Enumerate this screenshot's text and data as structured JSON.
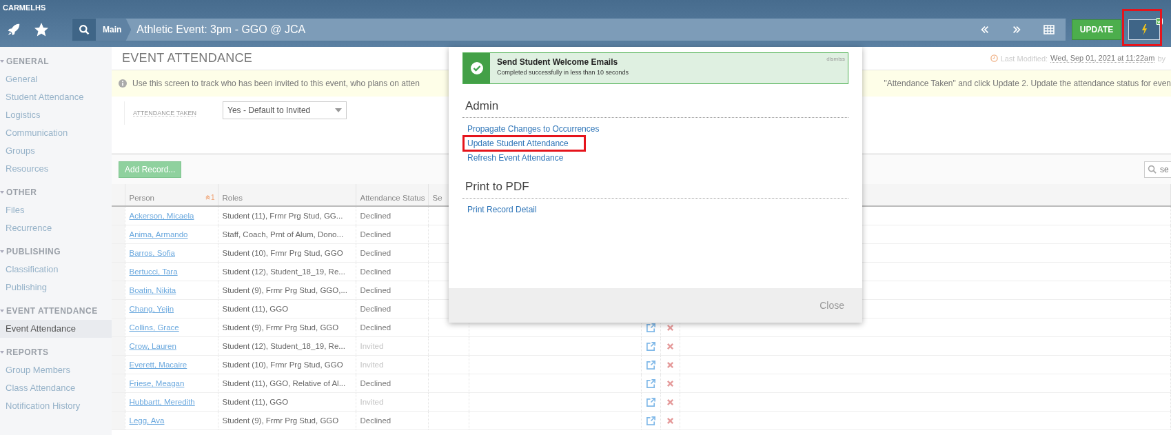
{
  "app": {
    "name": "CARMELHS"
  },
  "nav": {
    "search_label": "Main",
    "title": "Athletic Event: 3pm - GGO @ JCA",
    "update_button": "UPDATE",
    "actions_badge": true
  },
  "sidebar": [
    {
      "title": "GENERAL",
      "items": [
        {
          "label": "General",
          "selected": false
        },
        {
          "label": "Student Attendance",
          "selected": false
        },
        {
          "label": "Logistics",
          "selected": false
        },
        {
          "label": "Communication",
          "selected": false
        },
        {
          "label": "Groups",
          "selected": false
        },
        {
          "label": "Resources",
          "selected": false
        }
      ]
    },
    {
      "title": "OTHER",
      "items": [
        {
          "label": "Files",
          "selected": false
        },
        {
          "label": "Recurrence",
          "selected": false
        }
      ]
    },
    {
      "title": "PUBLISHING",
      "items": [
        {
          "label": "Classification",
          "selected": false
        },
        {
          "label": "Publishing",
          "selected": false
        }
      ]
    },
    {
      "title": "EVENT ATTENDANCE",
      "items": [
        {
          "label": "Event Attendance",
          "selected": true
        }
      ]
    },
    {
      "title": "REPORTS",
      "items": [
        {
          "label": "Group Members",
          "selected": false
        },
        {
          "label": "Class Attendance",
          "selected": false
        },
        {
          "label": "Notification History",
          "selected": false
        }
      ]
    }
  ],
  "page": {
    "title": "EVENT ATTENDANCE",
    "modified_label": "Last Modified:",
    "modified_value": "Wed, Sep 01, 2021 at 11:22am",
    "modified_by": "by",
    "info_left": "Use this screen to track who has been invited to this event, who plans on atten",
    "info_right": "\"Attendance Taken\" and click Update 2. Update the attendance status for even",
    "attendance_label": "ATTENDANCE TAKEN",
    "attendance_value": "Yes - Default to Invited",
    "add_button": "Add Record...",
    "search_placeholder": "se"
  },
  "table": {
    "columns": [
      "Person",
      "Roles",
      "Attendance Status",
      "Se"
    ],
    "sort_index": "1",
    "rows": [
      {
        "person": "Ackerson, Micaela",
        "roles": "Student (11), Frmr Prg Stud, GG...",
        "status": "Declined",
        "dimmed": false
      },
      {
        "person": "Anima, Armando",
        "roles": "Staff, Coach, Prnt of Alum, Dono...",
        "status": "Declined",
        "dimmed": false
      },
      {
        "person": "Barros, Sofia",
        "roles": "Student (10), Frmr Prg Stud, GGO",
        "status": "Declined",
        "dimmed": false
      },
      {
        "person": "Bertucci, Tara",
        "roles": "Student (12), Student_18_19, Re...",
        "status": "Declined",
        "dimmed": false
      },
      {
        "person": "Boatin, Nikita",
        "roles": "Student (9), Frmr Prg Stud, GGO,...",
        "status": "Declined",
        "dimmed": false
      },
      {
        "person": "Chang, Yejin",
        "roles": "Student (11), GGO",
        "status": "Declined",
        "dimmed": false
      },
      {
        "person": "Collins, Grace",
        "roles": "Student (9), Frmr Prg Stud, GGO",
        "status": "Declined",
        "dimmed": false
      },
      {
        "person": "Crow, Lauren",
        "roles": "Student (12), Student_18_19, Re...",
        "status": "Invited",
        "dimmed": true
      },
      {
        "person": "Everett, Macaire",
        "roles": "Student (10), Frmr Prg Stud, GGO",
        "status": "Invited",
        "dimmed": true
      },
      {
        "person": "Friese, Meagan",
        "roles": "Student (11), GGO, Relative of Al...",
        "status": "Declined",
        "dimmed": false
      },
      {
        "person": "Hubbartt, Meredith",
        "roles": "Student (11), GGO",
        "status": "Invited",
        "dimmed": true
      },
      {
        "person": "Legg, Ava",
        "roles": "Student (9), Frmr Prg Stud, GGO",
        "status": "Declined",
        "dimmed": false
      }
    ]
  },
  "popup": {
    "notice": {
      "title": "Send Student Welcome Emails",
      "message": "Completed successfully in less than 10 seconds",
      "dismiss": "dismiss"
    },
    "sections": [
      {
        "title": "Admin",
        "links": [
          {
            "label": "Propagate Changes to Occurrences",
            "highlighted": false
          },
          {
            "label": "Update Student Attendance",
            "highlighted": true
          },
          {
            "label": "Refresh Event Attendance",
            "highlighted": false
          }
        ]
      },
      {
        "title": "Print to PDF",
        "links": [
          {
            "label": "Print Record Detail",
            "highlighted": false
          }
        ]
      }
    ],
    "close": "Close"
  }
}
